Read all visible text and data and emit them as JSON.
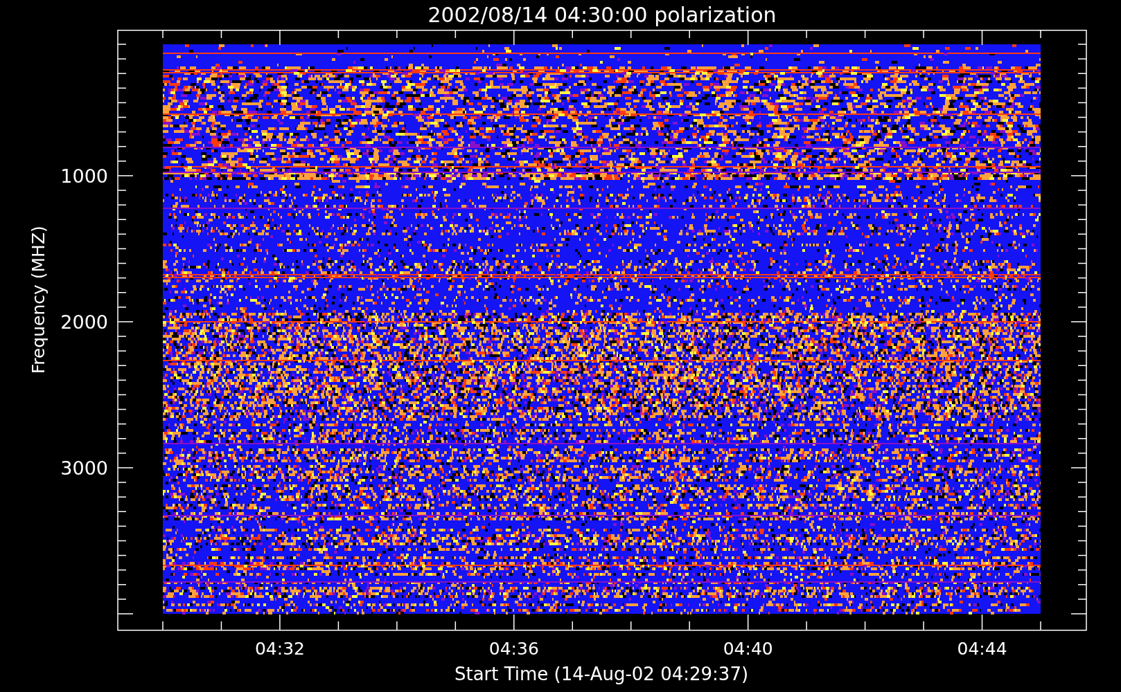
{
  "title": "2002/08/14 04:30:00 polarization",
  "x_axis": {
    "label": "Start Time (14-Aug-02 04:29:37)",
    "ticks": [
      "04:32",
      "04:36",
      "04:40",
      "04:44"
    ]
  },
  "y_axis": {
    "label": "Frequency (MHZ)",
    "ticks": [
      "1000",
      "2000",
      "3000"
    ]
  }
}
